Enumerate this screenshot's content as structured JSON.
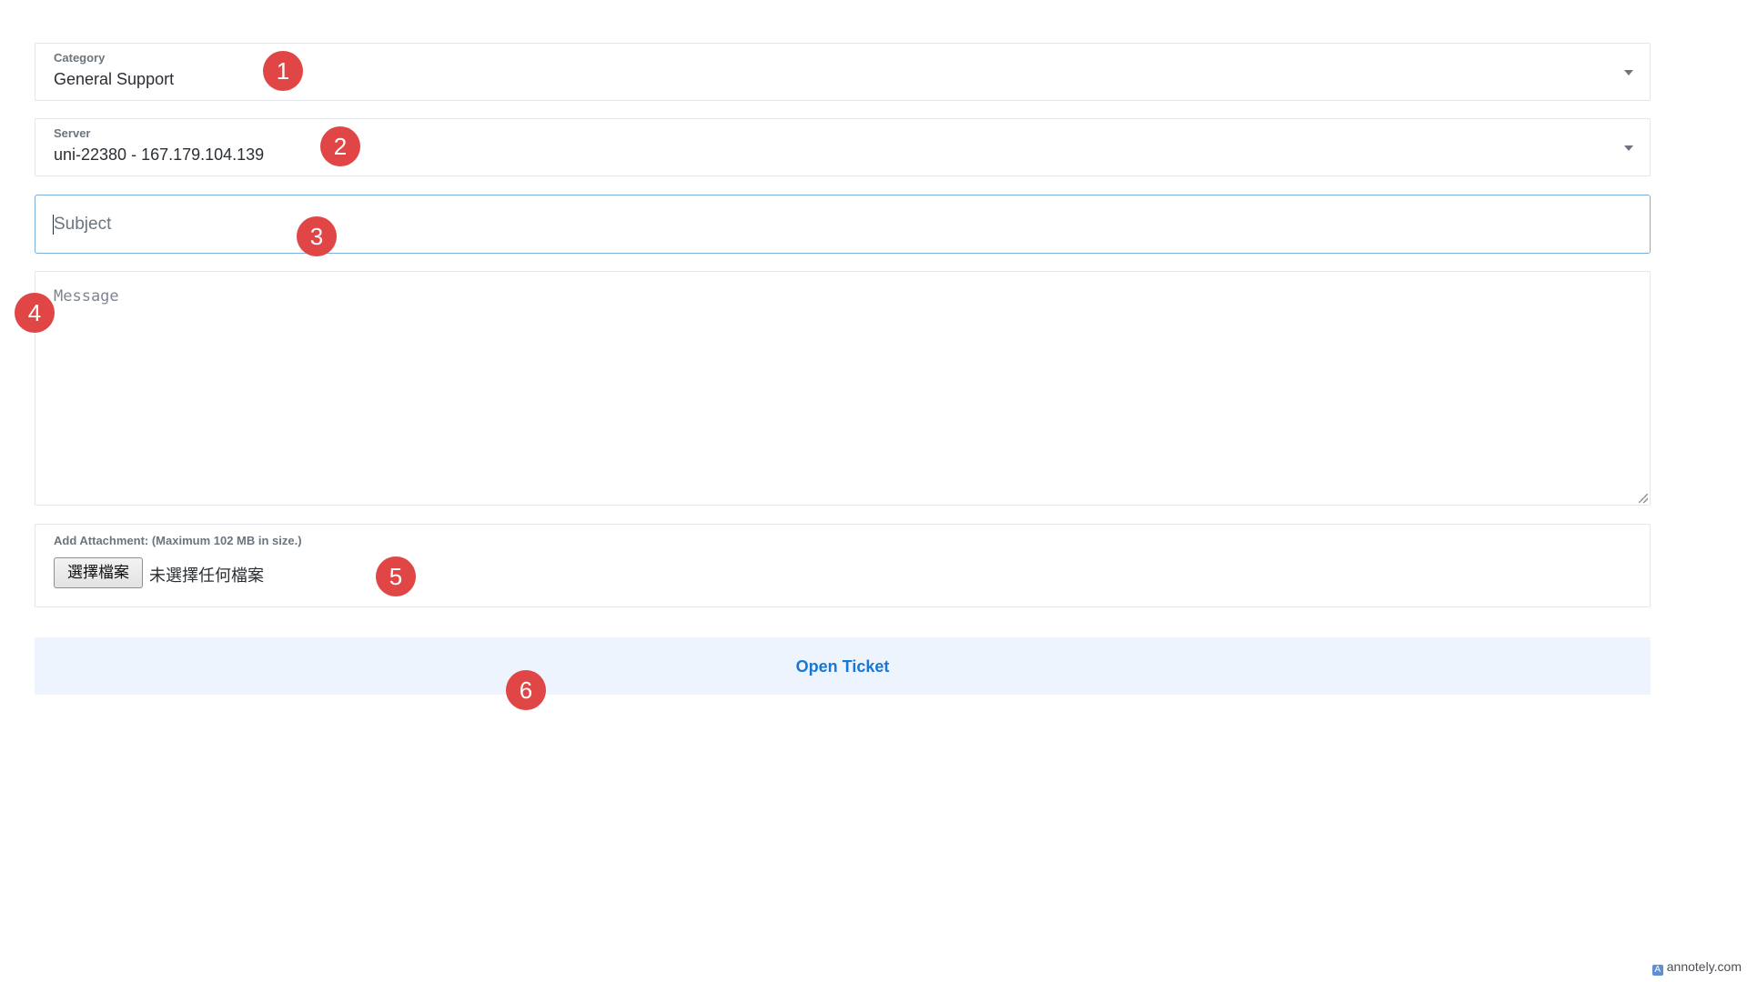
{
  "form": {
    "category": {
      "label": "Category",
      "value": "General Support"
    },
    "server": {
      "label": "Server",
      "value": "uni-22380 - 167.179.104.139"
    },
    "subject": {
      "value": "",
      "placeholder": "Subject"
    },
    "message": {
      "value": "",
      "placeholder": "Message"
    },
    "attachment": {
      "label": "Add Attachment: (Maximum 102 MB in size.)",
      "button_label": "選擇檔案",
      "status": "未選擇任何檔案"
    },
    "submit_label": "Open Ticket"
  },
  "annotations": {
    "markers": [
      "1",
      "2",
      "3",
      "4",
      "5",
      "6"
    ]
  },
  "watermark": {
    "text": "annotely.com"
  },
  "colors": {
    "accent": "#1877d2",
    "button_bg": "#eef4fd",
    "marker": "#e04646",
    "focus_border": "#7aaee0"
  }
}
